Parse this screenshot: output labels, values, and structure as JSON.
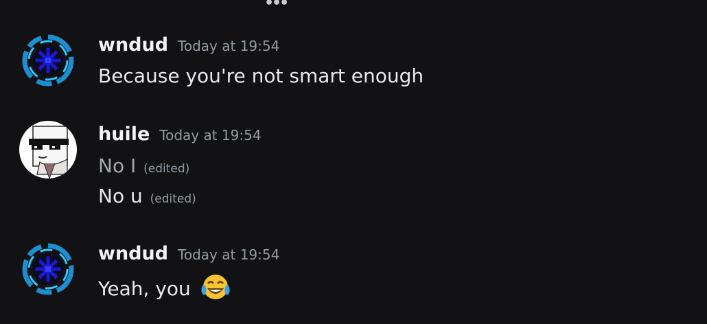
{
  "messages": [
    {
      "author": "wndud",
      "timestamp": "Today at 19:54",
      "avatar": "blue-snowflake-avatar",
      "lines": [
        {
          "text": "Because you're not smart enough",
          "edited": ""
        }
      ]
    },
    {
      "author": "huile",
      "timestamp": "Today at 19:54",
      "avatar": "sunglasses-character-avatar",
      "lines": [
        {
          "text": "No I",
          "edited": "(edited)"
        },
        {
          "text": "No u",
          "edited": "(edited)"
        }
      ]
    },
    {
      "author": "wndud",
      "timestamp": "Today at 19:54",
      "avatar": "blue-snowflake-avatar",
      "lines": [
        {
          "text": "Yeah, you",
          "edited": "",
          "emoji": "tears-of-joy-emoji"
        }
      ]
    }
  ],
  "colors": {
    "background": "#121214",
    "username": "#f2f3f5",
    "timestamp": "#949ba4",
    "message_text": "#e8e9ed",
    "accent_blue": "#1a1ad6"
  }
}
